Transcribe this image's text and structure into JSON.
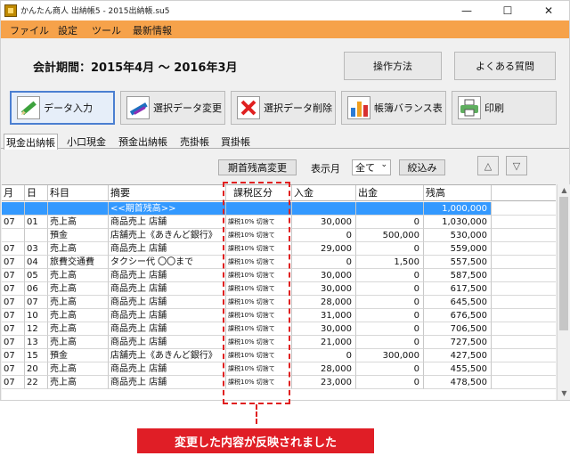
{
  "window": {
    "title": "かんたん商人 出納帳5 - 2015出納帳.su5",
    "controls": {
      "minimize": "—",
      "maximize": "☐",
      "close": "✕"
    }
  },
  "menu": [
    "ファイル",
    "設定",
    "ツール",
    "最新情報"
  ],
  "period": "会計期間：2015年4月 〜 2016年3月",
  "help_buttons": {
    "howto": "操作方法",
    "faq": "よくある質問"
  },
  "toolbar": {
    "entry": "データ入力",
    "change": "選択データ変更",
    "delete": "選択データ削除",
    "balance": "帳簿バランス表",
    "print": "印刷"
  },
  "tabs": [
    "現金出納帳",
    "小口現金",
    "預金出納帳",
    "売掛帳",
    "買掛帳"
  ],
  "controls": {
    "opening_balance_button": "期首残高変更",
    "month_label": "表示月",
    "month_value": "全て",
    "filter_button": "絞込み",
    "up": "△",
    "down": "▽"
  },
  "table": {
    "headers": [
      "月",
      "日",
      "科目",
      "摘要",
      "課税区分",
      "入金",
      "出金",
      "残高"
    ],
    "opening_row": {
      "summary": "<<期首残高>>",
      "balance": "1,000,000"
    },
    "rows": [
      [
        "07",
        "01",
        "売上高",
        "商品売上 店舗",
        "課税10% 切捨て",
        "30,000",
        "0",
        "1,030,000"
      ],
      [
        "",
        "",
        "預金",
        "店舗売上《あきんど銀行》",
        "課税10% 切捨て",
        "0",
        "500,000",
        "530,000"
      ],
      [
        "07",
        "03",
        "売上高",
        "商品売上 店舗",
        "課税10% 切捨て",
        "29,000",
        "0",
        "559,000"
      ],
      [
        "07",
        "04",
        "旅費交通費",
        "タクシー代 〇〇まで",
        "課税10% 切捨て",
        "0",
        "1,500",
        "557,500"
      ],
      [
        "07",
        "05",
        "売上高",
        "商品売上 店舗",
        "課税10% 切捨て",
        "30,000",
        "0",
        "587,500"
      ],
      [
        "07",
        "06",
        "売上高",
        "商品売上 店舗",
        "課税10% 切捨て",
        "30,000",
        "0",
        "617,500"
      ],
      [
        "07",
        "07",
        "売上高",
        "商品売上 店舗",
        "課税10% 切捨て",
        "28,000",
        "0",
        "645,500"
      ],
      [
        "07",
        "10",
        "売上高",
        "商品売上 店舗",
        "課税10% 切捨て",
        "31,000",
        "0",
        "676,500"
      ],
      [
        "07",
        "12",
        "売上高",
        "商品売上 店舗",
        "課税10% 切捨て",
        "30,000",
        "0",
        "706,500"
      ],
      [
        "07",
        "13",
        "売上高",
        "商品売上 店舗",
        "課税10% 切捨て",
        "21,000",
        "0",
        "727,500"
      ],
      [
        "07",
        "15",
        "預金",
        "店舗売上《あきんど銀行》",
        "課税10% 切捨て",
        "0",
        "300,000",
        "427,500"
      ],
      [
        "07",
        "20",
        "売上高",
        "商品売上 店舗",
        "課税10% 切捨て",
        "28,000",
        "0",
        "455,500"
      ],
      [
        "07",
        "22",
        "売上高",
        "商品売上 店舗",
        "課税10% 切捨て",
        "23,000",
        "0",
        "478,500"
      ]
    ]
  },
  "callout": "変更した内容が反映されました",
  "colors": {
    "menubar": "#f6a24a",
    "selection": "#3399ff",
    "callout": "#e01e26",
    "annotation": "#e02020"
  }
}
